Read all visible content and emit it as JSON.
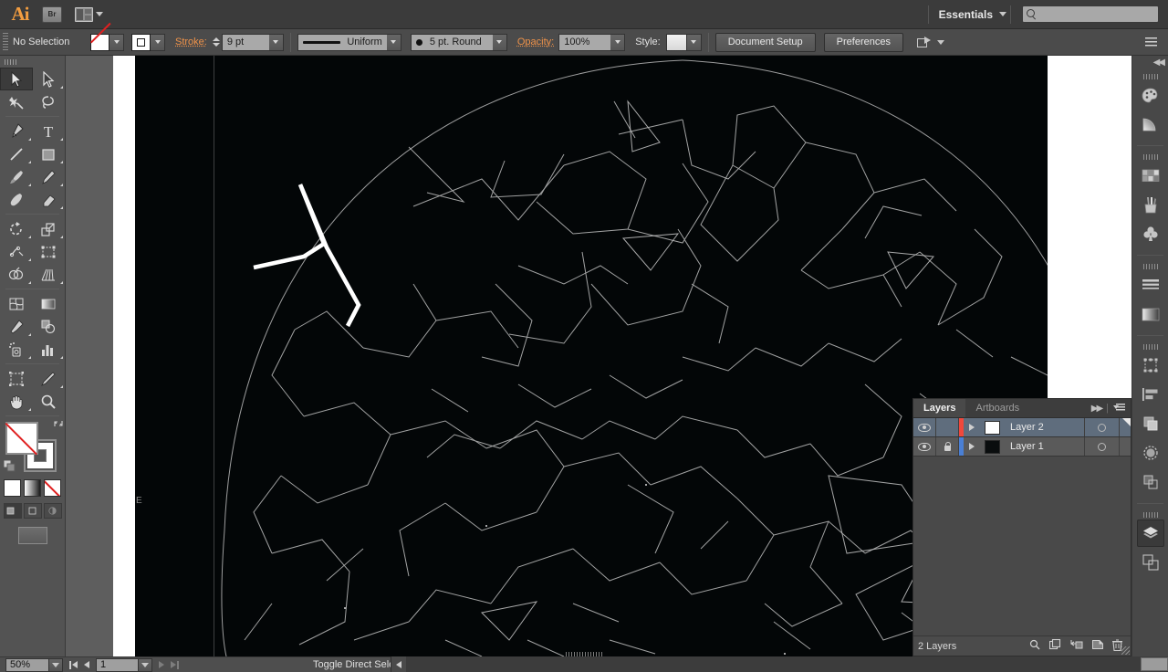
{
  "app": {
    "logo": "Ai",
    "bridge_button": "Br",
    "arrange_label": "arrange-documents"
  },
  "appbar": {
    "workspace": "Essentials",
    "search_placeholder": ""
  },
  "control_bar": {
    "selection_status": "No Selection",
    "fill_label": "fill-swatch",
    "stroke_swatch_label": "stroke-swatch",
    "stroke_label": "Stroke:",
    "stroke_weight": "9 pt",
    "stroke_profile": "Uniform",
    "brush_definition": "5 pt. Round",
    "opacity_label": "Opacity:",
    "opacity_value": "100%",
    "style_label": "Style:",
    "document_setup": "Document Setup",
    "preferences": "Preferences"
  },
  "toolbar": {
    "tools": [
      {
        "name": "selection-tool",
        "active": true,
        "more": false
      },
      {
        "name": "direct-selection-tool",
        "active": false,
        "more": true
      },
      {
        "name": "magic-wand-tool",
        "active": false,
        "more": false
      },
      {
        "name": "lasso-tool",
        "active": false,
        "more": false
      },
      {
        "name": "pen-tool",
        "active": false,
        "more": true
      },
      {
        "name": "type-tool",
        "active": false,
        "more": true
      },
      {
        "name": "line-segment-tool",
        "active": false,
        "more": true
      },
      {
        "name": "rectangle-tool",
        "active": false,
        "more": true
      },
      {
        "name": "paintbrush-tool",
        "active": false,
        "more": true
      },
      {
        "name": "pencil-tool",
        "active": false,
        "more": true
      },
      {
        "name": "blob-brush-tool",
        "active": false,
        "more": false
      },
      {
        "name": "eraser-tool",
        "active": false,
        "more": true
      },
      {
        "name": "rotate-tool",
        "active": false,
        "more": true
      },
      {
        "name": "scale-tool",
        "active": false,
        "more": true
      },
      {
        "name": "width-tool",
        "active": false,
        "more": true
      },
      {
        "name": "free-transform-tool",
        "active": false,
        "more": false
      },
      {
        "name": "shape-builder-tool",
        "active": false,
        "more": true
      },
      {
        "name": "perspective-grid-tool",
        "active": false,
        "more": true
      },
      {
        "name": "mesh-tool",
        "active": false,
        "more": false
      },
      {
        "name": "gradient-tool",
        "active": false,
        "more": false
      },
      {
        "name": "eyedropper-tool",
        "active": false,
        "more": true
      },
      {
        "name": "blend-tool",
        "active": false,
        "more": false
      },
      {
        "name": "symbol-sprayer-tool",
        "active": false,
        "more": true
      },
      {
        "name": "column-graph-tool",
        "active": false,
        "more": true
      },
      {
        "name": "artboard-tool",
        "active": false,
        "more": false
      },
      {
        "name": "slice-tool",
        "active": false,
        "more": true
      },
      {
        "name": "hand-tool",
        "active": false,
        "more": true
      },
      {
        "name": "zoom-tool",
        "active": false,
        "more": false
      }
    ],
    "fill_state": "none",
    "stroke_state": "white",
    "color_mode_buttons": [
      "color-button",
      "gradient-button",
      "none-button"
    ],
    "drawing_modes": [
      "draw-normal",
      "draw-behind",
      "draw-inside"
    ],
    "screen_mode": "change-screen-mode"
  },
  "layers_panel": {
    "tabs": [
      {
        "label": "Layers",
        "active": true
      },
      {
        "label": "Artboards",
        "active": false
      }
    ],
    "rows": [
      {
        "name": "Layer 2",
        "visible": true,
        "locked": false,
        "color": "#f0483c",
        "thumb": "#ffffff",
        "selected": true,
        "targeted": false
      },
      {
        "name": "Layer 1",
        "visible": true,
        "locked": true,
        "color": "#4a7fd4",
        "thumb": "#0a0d0e",
        "selected": false,
        "targeted": false
      }
    ],
    "footer_count": "2 Layers",
    "footer_icons": [
      "locate-object-icon",
      "make-clipping-mask-icon",
      "create-new-sublayer-icon",
      "create-new-layer-icon",
      "delete-selection-icon"
    ]
  },
  "dock": {
    "groups": [
      {
        "items": [
          {
            "name": "color-panel-icon",
            "active": false
          },
          {
            "name": "color-guide-panel-icon",
            "active": false
          }
        ]
      },
      {
        "items": [
          {
            "name": "swatches-panel-icon",
            "active": false
          },
          {
            "name": "brushes-panel-icon",
            "active": false
          },
          {
            "name": "symbols-panel-icon",
            "active": false
          }
        ]
      },
      {
        "items": [
          {
            "name": "stroke-panel-icon",
            "active": false
          },
          {
            "name": "gradient-panel-icon",
            "active": false
          }
        ]
      },
      {
        "items": [
          {
            "name": "transform-panel-icon",
            "active": false
          },
          {
            "name": "align-panel-icon",
            "active": false
          },
          {
            "name": "pathfinder-panel-icon",
            "active": false
          },
          {
            "name": "appearance-panel-icon",
            "active": false
          },
          {
            "name": "graphic-styles-panel-icon",
            "active": false
          }
        ]
      },
      {
        "items": [
          {
            "name": "layers-panel-icon",
            "active": true
          },
          {
            "name": "artboards-panel-icon",
            "active": false
          }
        ]
      }
    ]
  },
  "status_bar": {
    "zoom_level": "50%",
    "artboard_number": "1",
    "status_text": "Toggle Direct Selection"
  },
  "canvas": {
    "guide_letter": "E",
    "artwork_background": "#030607",
    "stroke_color": "#ffffff",
    "canvas_background": "#5e5e5e",
    "artboard_color": "#ffffff"
  }
}
